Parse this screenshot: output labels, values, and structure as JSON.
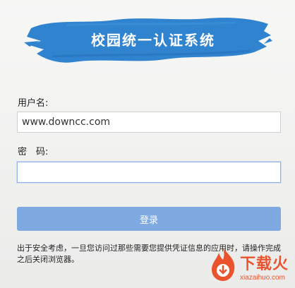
{
  "banner": {
    "title": "校园统一认证系统",
    "brush_color": "#2f83cf"
  },
  "form": {
    "username_label": "用户名:",
    "username_value": "www.downcc.com",
    "password_label": "密　码:",
    "password_value": "",
    "login_label": "登录"
  },
  "notice": "出于安全考虑，一旦您访问过那些需要您提供凭证信息的应用时，请操作完成之后关闭浏览器。",
  "watermark": {
    "text": "下载火",
    "sub": "xiazaihuo.com"
  },
  "colors": {
    "button": "#7ea9e1",
    "watermark": "#e9532d"
  }
}
